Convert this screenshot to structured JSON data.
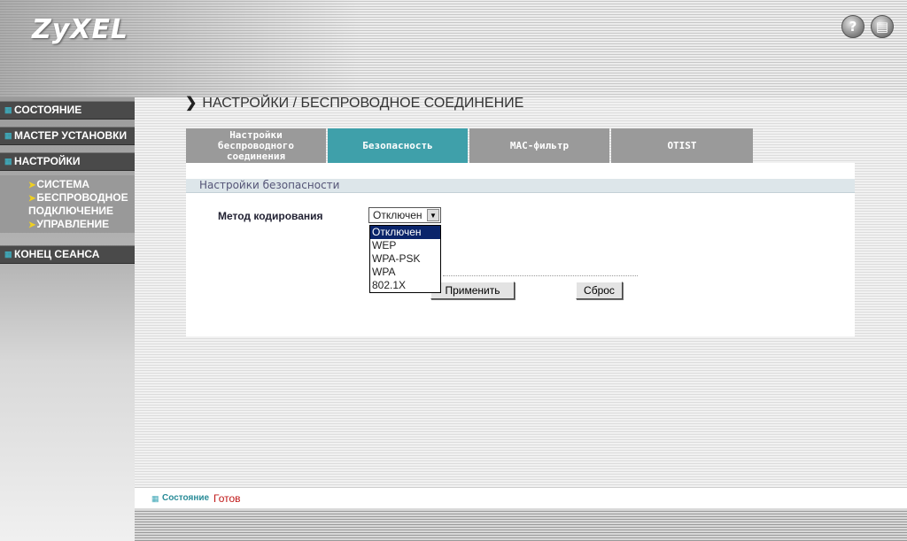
{
  "header": {
    "logo": "ZyXEL",
    "help_icon": "?",
    "exit_icon": "▤"
  },
  "sidebar": {
    "items": [
      {
        "label": "СОСТОЯНИЕ"
      },
      {
        "label": "МАСТЕР УСТАНОВКИ"
      },
      {
        "label": "НАСТРОЙКИ"
      },
      {
        "label": "КОНЕЦ СЕАНСА"
      }
    ],
    "subitems": [
      {
        "label": "СИСТЕМА"
      },
      {
        "label": "БЕСПРОВОДНОЕ"
      },
      {
        "label": "ПОДКЛЮЧЕНИЕ"
      },
      {
        "label": "УПРАВЛЕНИЕ"
      }
    ]
  },
  "main": {
    "title": "НАСТРОЙКИ / БЕСПРОВОДНОЕ СОЕДИНЕНИЕ",
    "tabs": [
      {
        "label_lines": [
          "Настройки",
          "беспроводного",
          "соединения"
        ]
      },
      {
        "label": "Безопасность",
        "active": true
      },
      {
        "label": "MAC-фильтр"
      },
      {
        "label": "OTIST"
      }
    ],
    "section_title": "Настройки безопасности",
    "encoding_label": "Метод кодирования",
    "encoding_value": "Отключен",
    "encoding_options": [
      "Отключен",
      "WEP",
      "WPA-PSK",
      "WPA",
      "802.1X"
    ],
    "apply_label": "Применить",
    "reset_label": "Сброс"
  },
  "status": {
    "label": "Состояние",
    "value": "Готов"
  },
  "colors": {
    "accent": "#3fa0aa",
    "nav_bg": "#4a4a4a",
    "selection": "#0a246a",
    "status_value": "#c01818"
  }
}
